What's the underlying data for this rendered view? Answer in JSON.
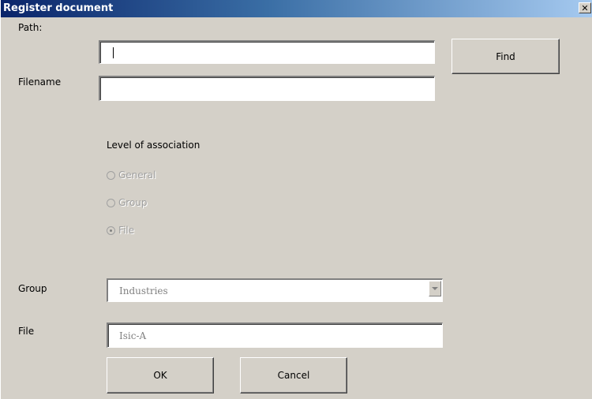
{
  "window": {
    "title": "Register document",
    "close_glyph": "✕"
  },
  "form": {
    "path_label": "Path:",
    "path_value": "",
    "filename_label": "Filename",
    "filename_value": "",
    "find_label": "Find",
    "association_heading": "Level of association",
    "radios": [
      {
        "label": "General",
        "checked": false,
        "enabled": false
      },
      {
        "label": "Group",
        "checked": false,
        "enabled": false
      },
      {
        "label": "File",
        "checked": true,
        "enabled": false
      }
    ],
    "group_label": "Group",
    "group_value": "Industries",
    "file_label": "File",
    "file_value": "Isic-A",
    "ok_label": "OK",
    "cancel_label": "Cancel"
  },
  "icons": {
    "close": "close-icon",
    "dropdown": "chevron-down-icon"
  }
}
